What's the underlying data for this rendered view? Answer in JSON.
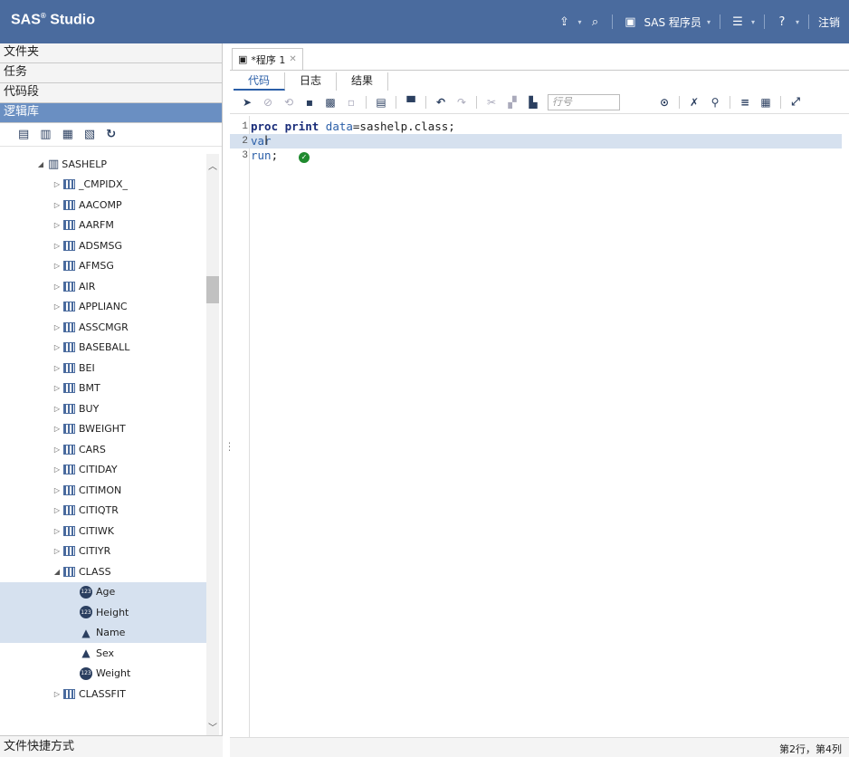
{
  "app": {
    "title": "SAS",
    "trademark": "®",
    "title_suffix": " Studio"
  },
  "topbar": {
    "user_label": "SAS 程序员",
    "signout": "注销"
  },
  "nav": {
    "folders": "文件夹",
    "tasks": "任务",
    "snippets": "代码段",
    "libraries": "逻辑库",
    "file_shortcuts": "文件快捷方式"
  },
  "tree": {
    "root": "SASHELP",
    "tables": [
      "_CMPIDX_",
      "AACOMP",
      "AARFM",
      "ADSMSG",
      "AFMSG",
      "AIR",
      "APPLIANC",
      "ASSCMGR",
      "BASEBALL",
      "BEI",
      "BMT",
      "BUY",
      "BWEIGHT",
      "CARS",
      "CITIDAY",
      "CITIMON",
      "CITIQTR",
      "CITIWK",
      "CITIYR",
      "CLASS"
    ],
    "columns": [
      {
        "name": "Age",
        "type": "numeric",
        "selected": true
      },
      {
        "name": "Height",
        "type": "numeric",
        "selected": true
      },
      {
        "name": "Name",
        "type": "character",
        "selected": true
      },
      {
        "name": "Sex",
        "type": "character",
        "selected": false
      },
      {
        "name": "Weight",
        "type": "numeric",
        "selected": false
      }
    ],
    "after": "CLASSFIT",
    "numeric_icon_text": "123"
  },
  "editor": {
    "tab_title": "*程序 1",
    "subtabs": [
      "代码",
      "日志",
      "结果"
    ],
    "line_placeholder": "行号",
    "lines": [
      {
        "num": "1",
        "parts": [
          [
            "kw",
            "proc print "
          ],
          [
            "opt",
            "data"
          ],
          [
            "plain",
            "=sashelp.class;"
          ]
        ]
      },
      {
        "num": "2",
        "parts": [
          [
            "opt",
            "var "
          ]
        ]
      },
      {
        "num": "3",
        "parts": [
          [
            "opt",
            "run"
          ],
          [
            "plain",
            ";"
          ]
        ]
      }
    ],
    "status": "第2行，第4列"
  }
}
